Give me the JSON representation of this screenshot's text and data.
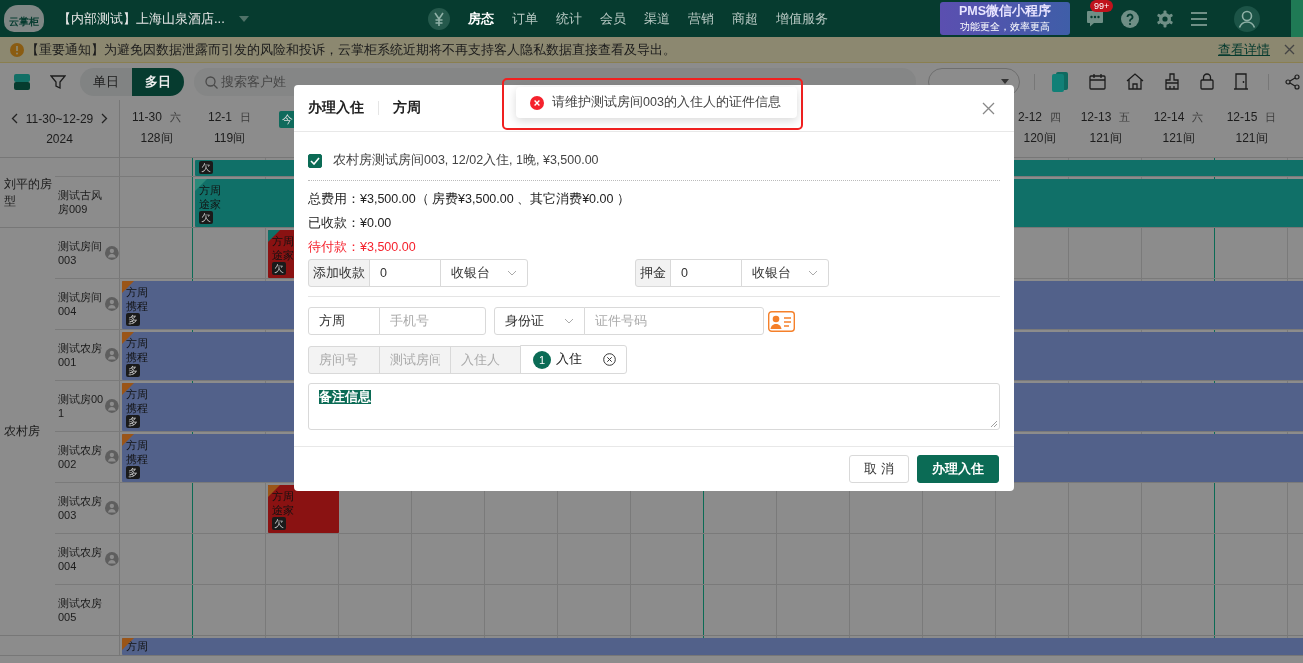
{
  "top_bar": {
    "logo": "云掌柜",
    "hotel": "【内部测试】上海山泉酒店...",
    "nav": [
      {
        "label": "房态",
        "selected": true
      },
      {
        "label": "订单",
        "selected": false
      },
      {
        "label": "统计",
        "selected": false
      },
      {
        "label": "会员",
        "selected": false
      },
      {
        "label": "渠道",
        "selected": false
      },
      {
        "label": "营销",
        "selected": false
      },
      {
        "label": "商超",
        "selected": false
      },
      {
        "label": "增值服务",
        "selected": false
      }
    ],
    "promo": {
      "title": "PMS微信小程序",
      "subtitle": "功能更全，效率更高"
    },
    "message_count": "99+"
  },
  "notice": {
    "text": "【重要通知】为避免因数据泄露而引发的风险和投诉，云掌柜系统近期将不再支持客人隐私数据直接查看及导出。",
    "link": "查看详情"
  },
  "toolbar": {
    "view_modes": [
      {
        "label": "单日",
        "selected": false
      },
      {
        "label": "多日",
        "selected": true
      }
    ],
    "search": {
      "placeholder": "搜索客户姓"
    }
  },
  "calendar": {
    "range": "11-30~12-29",
    "year": "2024",
    "headers_left": [
      {
        "kind": "day",
        "date": "11-30",
        "weekday": "六",
        "rooms": "128间"
      },
      {
        "kind": "day",
        "date": "12-1",
        "weekday": "日",
        "rooms": "119间"
      },
      {
        "kind": "today",
        "badge": "今"
      }
    ],
    "headers_right": [
      {
        "kind": "day_clipped",
        "date": "2-12",
        "weekday": "四",
        "rooms": "120间"
      },
      {
        "kind": "day",
        "date": "12-13",
        "weekday": "五",
        "rooms": "121间"
      },
      {
        "kind": "day",
        "date": "12-14",
        "weekday": "六",
        "rooms": "121间"
      },
      {
        "kind": "day",
        "date": "12-15",
        "weekday": "日",
        "rooms": "121间"
      }
    ],
    "groups": [
      {
        "name": "刘平的房型",
        "rooms": [
          {
            "bars": [
              {
                "kind": "in_house",
                "color": "#107068",
                "badge": "欠"
              }
            ]
          },
          {
            "name": "测试古风房009",
            "bars": [
              {
                "kind": "in_house",
                "color": "#107068",
                "flag": {
                  "color": "#2a8a7a"
                },
                "guest": "方周",
                "channel": "途家",
                "badge": "欠"
              }
            ]
          }
        ]
      },
      {
        "name": "农村房",
        "rooms": [
          {
            "name": "测试房间003",
            "status_icon": true,
            "bars": [
              {
                "kind": "arriving_today",
                "color": "#8a1212",
                "flag": {
                  "color": "#107068"
                },
                "guest": "方周",
                "channel": "途家",
                "badge": "欠"
              }
            ]
          },
          {
            "name": "测试房间004",
            "status_icon": true,
            "bars": [
              {
                "kind": "ongoing",
                "color": "#52618a",
                "flag": {
                  "color": "#9a5518"
                },
                "guest": "方周",
                "channel": "携程",
                "badge": "多"
              }
            ]
          },
          {
            "name": "测试农房001",
            "status_icon": true,
            "bars": [
              {
                "kind": "ongoing",
                "color": "#52618a",
                "flag": {
                  "color": "#9a5518"
                },
                "guest": "方周",
                "channel": "携程",
                "badge": "多"
              }
            ]
          },
          {
            "name": "测试房001",
            "status_icon": true,
            "bars": [
              {
                "kind": "ongoing",
                "color": "#52618a",
                "flag": {
                  "color": "#9a5518"
                },
                "guest": "方周",
                "channel": "携程",
                "badge": "多"
              }
            ]
          },
          {
            "name": "测试农房002",
            "status_icon": true,
            "bars": [
              {
                "kind": "ongoing",
                "color": "#52618a",
                "flag": {
                  "color": "#9a5518"
                },
                "guest": "方周",
                "channel": "携程",
                "badge": "多"
              }
            ]
          },
          {
            "name": "测试农房003",
            "status_icon": true,
            "bars": [
              {
                "kind": "arriving_today",
                "color": "#8a1212",
                "flag": {
                  "color": "#9a5518"
                },
                "guest": "方周",
                "channel": "途家",
                "badge": "欠"
              }
            ]
          },
          {
            "name": "测试农房004",
            "status_icon": true
          },
          {
            "name": "测试农房005"
          }
        ]
      },
      {
        "rooms": [
          {
            "bars": [
              {
                "kind": "ongoing",
                "color": "#52618a",
                "flag": {
                  "color": "#9a5518"
                },
                "guest": "方周"
              }
            ]
          }
        ]
      }
    ]
  },
  "checkin_dialog": {
    "title": "办理入住",
    "guest": "方周",
    "rooms": [
      {
        "label": "农村房测试房间003, 12/02入住, 1晚, ¥3,500.00",
        "checked": true
      }
    ],
    "summary": [
      {
        "kind": "normal",
        "text": "总费用：¥3,500.00（ 房费¥3,500.00 、其它消费¥0.00 ）"
      },
      {
        "kind": "normal",
        "text": "已收款：¥0.00"
      },
      {
        "kind": "due",
        "text": "待付款：¥3,500.00"
      }
    ],
    "payments": [
      {
        "label": "添加收款",
        "amount": "0",
        "method": "收银台"
      },
      {
        "label": "押金",
        "amount": "0",
        "method": "收银台"
      }
    ],
    "guest_form": {
      "name": "方周",
      "phone": {
        "placeholder": "手机号"
      },
      "id_type": "身份证",
      "id_number": {
        "placeholder": "证件号码"
      }
    },
    "assign": {
      "room_no": {
        "placeholder": "房间号"
      },
      "room_type": {
        "placeholder": "测试房间"
      },
      "occupant": {
        "placeholder": "入住人"
      },
      "tag": {
        "count": "1",
        "label": "入住"
      }
    },
    "remarks": {
      "text": "备注信息",
      "selected": true
    },
    "buttons": [
      {
        "kind": "default",
        "label": "取 消"
      },
      {
        "kind": "primary",
        "label": "办理入住"
      }
    ]
  },
  "toast": {
    "kind": "error",
    "message": "请维护测试房间003的入住人的证件信息",
    "highlighted": true
  }
}
